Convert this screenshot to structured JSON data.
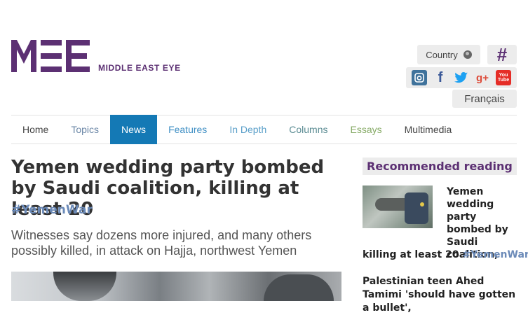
{
  "header": {
    "brand_mark": "MEE",
    "brand_name": "MIDDLE EAST EYE",
    "brand_color": "#5c3073",
    "country_label": "Country",
    "hashtag_label": "#",
    "language_label": "Français",
    "socials": [
      {
        "name": "instagram-icon",
        "glyph": "◘"
      },
      {
        "name": "facebook-icon",
        "glyph": "f"
      },
      {
        "name": "twitter-icon",
        "glyph": "🐦"
      },
      {
        "name": "google-plus-icon",
        "glyph": "g+"
      },
      {
        "name": "youtube-icon",
        "glyph": "You Tube"
      }
    ]
  },
  "nav": {
    "items": [
      {
        "label": "Home",
        "color": "#444444"
      },
      {
        "label": "Topics",
        "color": "#6a86a6"
      },
      {
        "label": "News",
        "color": "#ffffff",
        "active": true
      },
      {
        "label": "Features",
        "color": "#3f8fc4"
      },
      {
        "label": "In Depth",
        "color": "#5a9fc9"
      },
      {
        "label": "Columns",
        "color": "#5a8b92"
      },
      {
        "label": "Essays",
        "color": "#86aa66"
      },
      {
        "label": "Multimedia",
        "color": "#444444"
      }
    ],
    "active_color": "#1479b5"
  },
  "article": {
    "headline": "Yemen wedding party bombed by Saudi coalition, killing at least 20",
    "tag": "#YemenWar",
    "standfirst": "Witnesses say dozens more injured, and many others possibly killed, in attack on Hajja, northwest Yemen"
  },
  "sidebar": {
    "title": "Recommended reading",
    "items": [
      {
        "headline_part1": "Yemen wedding party bombed by Saudi coalition,",
        "headline_part2": "killing at least 20",
        "tag": "#YemenWar"
      },
      {
        "headline": "Palestinian teen Ahed Tamimi 'should have gotten a bullet',"
      }
    ]
  }
}
